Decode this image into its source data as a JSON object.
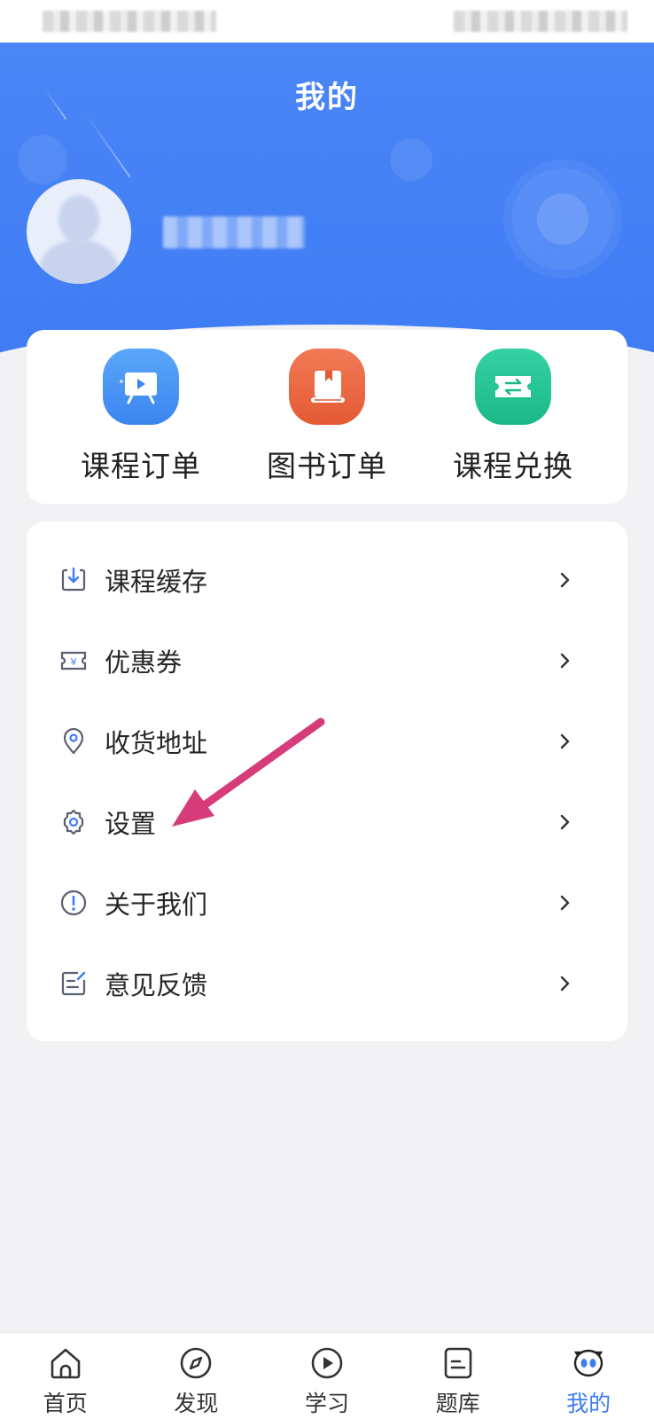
{
  "header": {
    "title": "我的",
    "accent_color": "#3f7cf4"
  },
  "quick_actions": [
    {
      "label": "课程订单",
      "icon": "course-order-icon"
    },
    {
      "label": "图书订单",
      "icon": "book-order-icon"
    },
    {
      "label": "课程兑换",
      "icon": "course-exchange-icon"
    }
  ],
  "menu": [
    {
      "label": "课程缓存",
      "icon": "download-icon"
    },
    {
      "label": "优惠券",
      "icon": "coupon-icon"
    },
    {
      "label": "收货地址",
      "icon": "location-icon"
    },
    {
      "label": "设置",
      "icon": "gear-icon"
    },
    {
      "label": "关于我们",
      "icon": "info-icon"
    },
    {
      "label": "意见反馈",
      "icon": "feedback-icon"
    }
  ],
  "bottom_nav": [
    {
      "label": "首页",
      "icon": "home-icon"
    },
    {
      "label": "发现",
      "icon": "compass-icon"
    },
    {
      "label": "学习",
      "icon": "play-icon"
    },
    {
      "label": "题库",
      "icon": "question-bank-icon"
    },
    {
      "label": "我的",
      "icon": "profile-icon",
      "active": true
    }
  ],
  "annotation": {
    "color": "#d63c7a"
  }
}
